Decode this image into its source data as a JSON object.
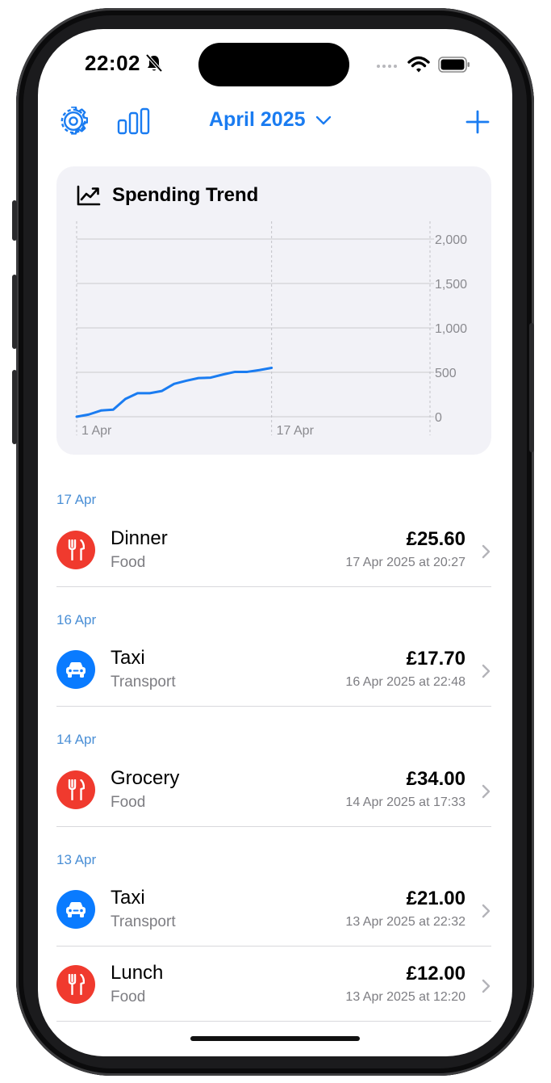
{
  "status_bar": {
    "time": "22:02"
  },
  "nav": {
    "month_label": "April 2025"
  },
  "trend_card": {
    "title": "Spending Trend"
  },
  "chart_data": {
    "type": "line",
    "title": "Spending Trend",
    "x_tick_labels": [
      "1 Apr",
      "17 Apr"
    ],
    "y_ticks": [
      0,
      500,
      1000,
      1500,
      2000
    ],
    "y_tick_labels": [
      "0",
      "500",
      "1,000",
      "1,500",
      "2,000"
    ],
    "ylim": [
      0,
      2000
    ],
    "xlim": [
      1,
      30
    ],
    "x_axis": "day of April 2025",
    "grid": true,
    "series": [
      {
        "x": [
          1,
          2,
          3,
          4,
          5,
          6,
          7,
          8,
          9,
          10,
          11,
          12,
          13,
          14,
          15,
          16,
          17
        ],
        "values": [
          0,
          25,
          70,
          80,
          200,
          265,
          265,
          290,
          370,
          405,
          435,
          440,
          475,
          505,
          505,
          525,
          550
        ],
        "color": "#1a7cf1"
      }
    ]
  },
  "sections": [
    {
      "header": "17 Apr",
      "items": [
        {
          "title": "Dinner",
          "category": "Food",
          "amount": "£25.60",
          "datetime": "17 Apr 2025 at 20:27",
          "icon": "fork-knife-icon"
        }
      ]
    },
    {
      "header": "16 Apr",
      "items": [
        {
          "title": "Taxi",
          "category": "Transport",
          "amount": "£17.70",
          "datetime": "16 Apr 2025 at 22:48",
          "icon": "car-icon"
        }
      ]
    },
    {
      "header": "14 Apr",
      "items": [
        {
          "title": "Grocery",
          "category": "Food",
          "amount": "£34.00",
          "datetime": "14 Apr 2025 at 17:33",
          "icon": "fork-knife-icon"
        }
      ]
    },
    {
      "header": "13 Apr",
      "items": [
        {
          "title": "Taxi",
          "category": "Transport",
          "amount": "£21.00",
          "datetime": "13 Apr 2025 at 22:32",
          "icon": "car-icon"
        },
        {
          "title": "Lunch",
          "category": "Food",
          "amount": "£12.00",
          "datetime": "13 Apr 2025 at 12:20",
          "icon": "fork-knife-icon"
        }
      ]
    }
  ],
  "colors": {
    "accent": "#1a7cf1",
    "food": "#f03a2e",
    "transport": "#0a7bff",
    "section_header": "#4a8fd6"
  }
}
